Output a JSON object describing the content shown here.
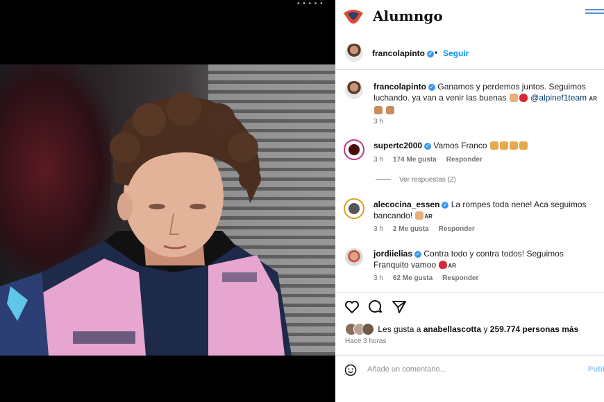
{
  "top_indicator": "• • • • •",
  "brand": {
    "title": "Alumngo"
  },
  "post_header": {
    "username": "francolapinto",
    "follow_label": "Seguir",
    "separator": "•"
  },
  "caption": {
    "username": "francolapinto",
    "text": "Ganamos y perdemos juntos. Seguimos luchando. ya van a venir las buenas",
    "mention": "@alpinef1team",
    "flag": "AR",
    "time": "3 h"
  },
  "comments": [
    {
      "username": "supertc2000",
      "text": "Vamos Franco",
      "time": "3 h",
      "likes": "174 Me gusta",
      "reply": "Responder"
    },
    {
      "username": "alecocina_essen",
      "text": "La rompes toda nene! Aca seguimos bancando!",
      "flag": "AR",
      "time": "3 h",
      "likes": "2 Me gusta",
      "reply": "Responder"
    },
    {
      "username": "jordiielias",
      "text": "Contra todo y contra todos! Seguimos Franquito vamoo",
      "flag": "AR",
      "time": "3 h",
      "likes": "62 Me gusta",
      "reply": "Responder"
    }
  ],
  "view_replies": "Ver respuestas (2)",
  "likes_line": {
    "prefix": "Les gusta a",
    "user": "anabellascotta",
    "middle": "y",
    "count": "259.774 personas más"
  },
  "posted_ago": "Hace 3 horas",
  "comment_input": {
    "placeholder": "Añade un comentario...",
    "post_label": "Publ"
  },
  "icons": [
    "heart-icon",
    "comment-icon",
    "share-icon",
    "emoji-icon",
    "menu-icon",
    "verified-icon"
  ],
  "colors": {
    "accent": "#0095f6",
    "verified": "#3897f0",
    "muted": "#737373"
  }
}
